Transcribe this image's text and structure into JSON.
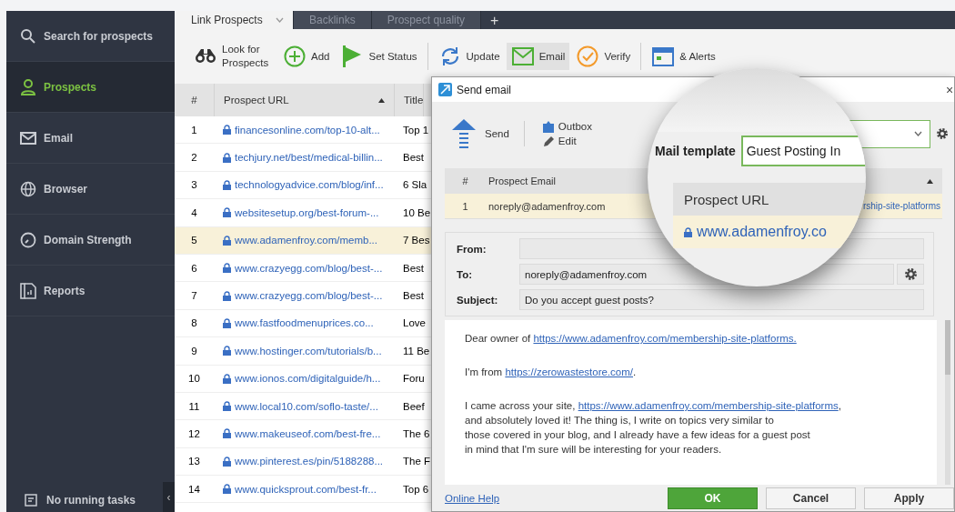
{
  "sidebar": {
    "items": [
      {
        "label": "Search for prospects",
        "selected": false
      },
      {
        "label": "Prospects",
        "selected": true
      },
      {
        "label": "Email",
        "selected": false
      },
      {
        "label": "Browser",
        "selected": false
      },
      {
        "label": "Domain Strength",
        "selected": false
      },
      {
        "label": "Reports",
        "selected": false
      }
    ],
    "tasks": "No running tasks",
    "collapse": "‹"
  },
  "tabs": [
    {
      "label": "Link Prospects",
      "selected": true
    },
    {
      "label": "Backlinks",
      "selected": false
    },
    {
      "label": "Prospect quality",
      "selected": false
    }
  ],
  "add_tab": "+",
  "toolbar": [
    {
      "label": "Look for Prospects",
      "selected": false
    },
    {
      "label": "Add",
      "selected": false
    },
    {
      "label": "Set Status",
      "selected": false
    },
    {
      "label": "Update",
      "selected": false
    },
    {
      "label": "Email",
      "selected": true
    },
    {
      "label": "Verify",
      "selected": false
    },
    {
      "label": "& Alerts",
      "selected": false
    }
  ],
  "table": {
    "columns": [
      "#",
      "Prospect URL",
      "Title"
    ],
    "rows": [
      {
        "number": "1",
        "url": "financesonline.com/top-10-alt...",
        "title": "Top 1",
        "selected": false
      },
      {
        "number": "2",
        "url": "techjury.net/best/medical-billin...",
        "title": "Best",
        "selected": false
      },
      {
        "number": "3",
        "url": "technologyadvice.com/blog/inf...",
        "title": "6 Sla",
        "selected": false
      },
      {
        "number": "4",
        "url": "websitesetup.org/best-forum-...",
        "title": "10 Be",
        "selected": false
      },
      {
        "number": "5",
        "url": "www.adamenfroy.com/memb...",
        "title": "7 Bes",
        "selected": true
      },
      {
        "number": "6",
        "url": "www.crazyegg.com/blog/best-...",
        "title": "Best",
        "selected": false
      },
      {
        "number": "7",
        "url": "www.crazyegg.com/blog/best-...",
        "title": "Best",
        "selected": false
      },
      {
        "number": "8",
        "url": "www.fastfoodmenuprices.co...",
        "title": "Love",
        "selected": false
      },
      {
        "number": "9",
        "url": "www.hostinger.com/tutorials/b...",
        "title": "11 Be",
        "selected": false
      },
      {
        "number": "10",
        "url": "www.ionos.com/digitalguide/h...",
        "title": "Foru",
        "selected": false
      },
      {
        "number": "11",
        "url": "www.local10.com/soflo-taste/...",
        "title": "Beef",
        "selected": false
      },
      {
        "number": "12",
        "url": "www.makeuseof.com/best-fre...",
        "title": "The 6",
        "selected": false
      },
      {
        "number": "13",
        "url": "www.pinterest.es/pin/5188288...",
        "title": "The F",
        "selected": false
      },
      {
        "number": "14",
        "url": "www.quicksprout.com/best-fr...",
        "title": "Top 6",
        "selected": false
      }
    ]
  },
  "dialog": {
    "title": "Send email",
    "close": "×",
    "toolbar": [
      "Send",
      "Outbox",
      "Edit"
    ],
    "table": {
      "columns": [
        "#",
        "Prospect Email"
      ],
      "rows": [
        {
          "number": "1",
          "email": "noreply@adamenfroy.com",
          "url": "rship-site-platforms",
          "selected": true
        }
      ]
    },
    "magnifier": {
      "label": "Mail template",
      "value": "Guest Posting In",
      "column": "Prospect URL",
      "cell": "www.adamenfroy.co"
    },
    "form": [
      {
        "label": "From:"
      },
      {
        "label": "To:",
        "value": "noreply@adamenfroy.com"
      },
      {
        "label": "Subject:",
        "value": "Do you accept guest posts?"
      }
    ],
    "body": [
      {
        "lines": [
          [
            {
              "kind": "text",
              "text": "Dear owner of "
            },
            {
              "kind": "link",
              "text": "https://www.adamenfroy.com/membership-site-platforms."
            }
          ]
        ]
      },
      {
        "lines": [
          [
            {
              "kind": "text",
              "text": "I'm  from "
            },
            {
              "kind": "link",
              "text": "https://zerowastestore.com/"
            },
            {
              "kind": "text",
              "text": "."
            }
          ]
        ]
      },
      {
        "lines": [
          [
            {
              "kind": "text",
              "text": "I came across your site, "
            },
            {
              "kind": "link",
              "text": "https://www.adamenfroy.com/membership-site-platforms"
            },
            {
              "kind": "text",
              "text": ","
            }
          ],
          [
            {
              "kind": "text",
              "text": "and absolutely loved it! The thing is, I write on topics very similar to"
            }
          ],
          [
            {
              "kind": "text",
              "text": "those covered in your blog, and I already have a few ideas for a guest post"
            }
          ],
          [
            {
              "kind": "text",
              "text": "in mind that I'm sure will be interesting for your readers."
            }
          ]
        ]
      }
    ],
    "help": "Online Help",
    "buttons": [
      {
        "label": "OK",
        "kind": "primary"
      },
      {
        "label": "Cancel",
        "kind": "default"
      },
      {
        "label": "Apply",
        "kind": "default"
      }
    ]
  }
}
